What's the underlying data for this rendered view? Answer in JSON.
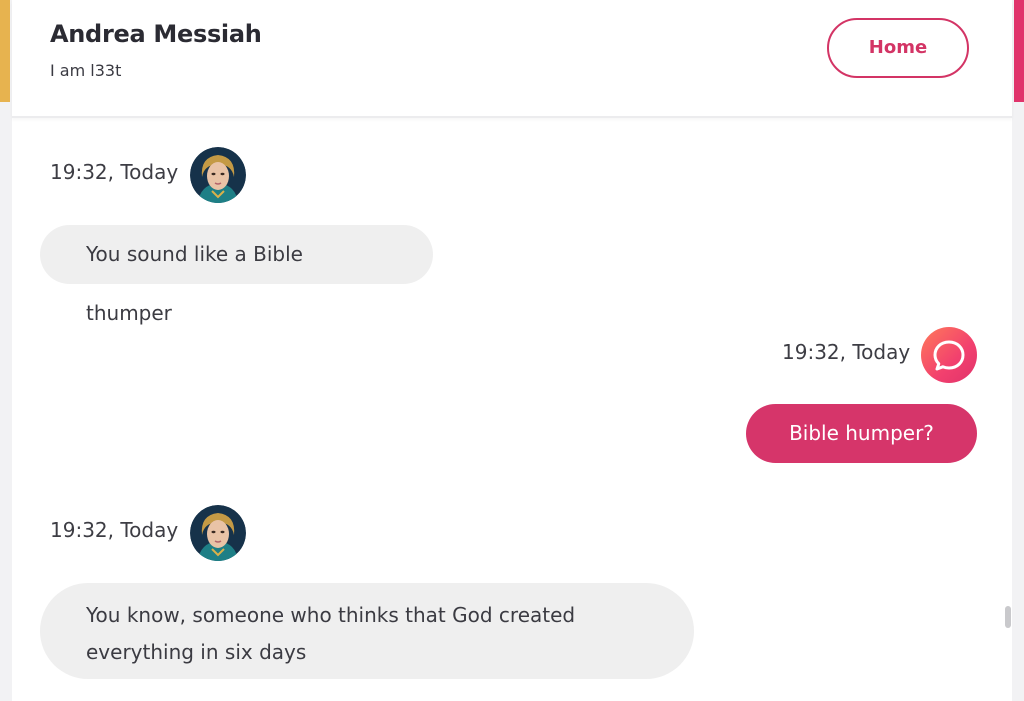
{
  "header": {
    "contact_name": "Andrea Messiah",
    "contact_status": "I am l33t",
    "home_label": "Home"
  },
  "messages": [
    {
      "direction": "incoming",
      "time": "19:32, Today",
      "text": "You sound like a Bible thumper"
    },
    {
      "direction": "outgoing",
      "time": "19:32, Today",
      "text": "Bible humper?"
    },
    {
      "direction": "incoming",
      "time": "19:32, Today",
      "text_line1": "You know, someone who thinks that God created",
      "text_line2": "everything in six days"
    }
  ],
  "icons": {
    "contact_avatar": "contact-avatar-image",
    "user_avatar": "speech-bubble-icon"
  },
  "colors": {
    "accent_pink": "#d6356a",
    "accent_gold": "#e7b34f",
    "incoming_bubble": "#efefef",
    "outgoing_text": "#ffffff"
  }
}
